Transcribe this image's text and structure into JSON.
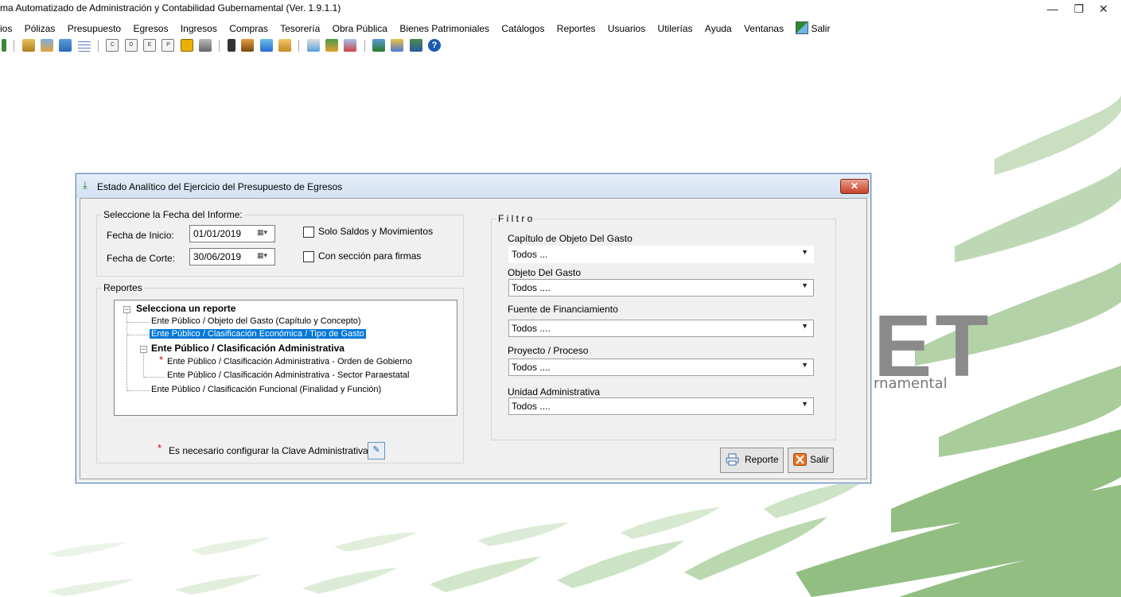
{
  "window": {
    "title": "ma Automatizado de Administración y Contabilidad Gubernamental  (Ver. 1.9.1.1)",
    "min": "—",
    "max": "❐",
    "close": "✕"
  },
  "menu": [
    "ios",
    "Pólizas",
    "Presupuesto",
    "Egresos",
    "Ingresos",
    "Compras",
    "Tesorería",
    "Obra Pública",
    "Bienes Patrimoniales",
    "Catálogos",
    "Reportes",
    "Usuarios",
    "Utilerías",
    "Ayuda",
    "Ventanas",
    "Salir"
  ],
  "background": {
    "logo_text": "ET",
    "tagline": "rnamental",
    "accent": "#6aa35a"
  },
  "dialog": {
    "title": "Estado Analítico del Ejercicio del Presupuesto de Egresos",
    "close": "✕",
    "fecha_group": {
      "legend": "Seleccione la Fecha del Informe:",
      "inicio_label": "Fecha de Inicio:",
      "inicio_value": "01/01/2019",
      "corte_label": "Fecha de Corte:",
      "corte_value": "30/06/2019",
      "chk_saldos": "Solo Saldos y Movimientos",
      "chk_firmas": "Con sección para firmas"
    },
    "reportes_group": {
      "legend": "Reportes",
      "root": "Selecciona un reporte",
      "items": [
        "Ente Público  /  Objeto del Gasto (Capítulo y Concepto)",
        "Ente Público  /  Clasificación Económica / Tipo de Gasto",
        "Ente Público  /  Clasificación Administrativa",
        "Ente Público  /  Clasificación Administrativa - Orden de Gobierno",
        "Ente Público  /  Clasificación Administrativa - Sector Paraestatal",
        "Ente Público  /  Clasificación Funcional (Finalidad y Función)"
      ],
      "note": "Es necesario configurar la Clave Administrativa"
    },
    "filtro": {
      "legend": "F i l t r o",
      "capitulo_label": "Capítulo de Objeto Del Gasto",
      "capitulo_value": "Todos  ...",
      "objeto_label": "Objeto Del Gasto",
      "objeto_value": "Todos ....",
      "fuente_label": "Fuente de Financiamiento",
      "fuente_value": "Todos ....",
      "proyecto_label": "Proyecto / Proceso",
      "proyecto_value": "Todos ....",
      "unidad_label": "Unidad Administrativa",
      "unidad_value": "Todos ...."
    },
    "buttons": {
      "reporte": "Reporte",
      "salir": "Salir"
    }
  }
}
